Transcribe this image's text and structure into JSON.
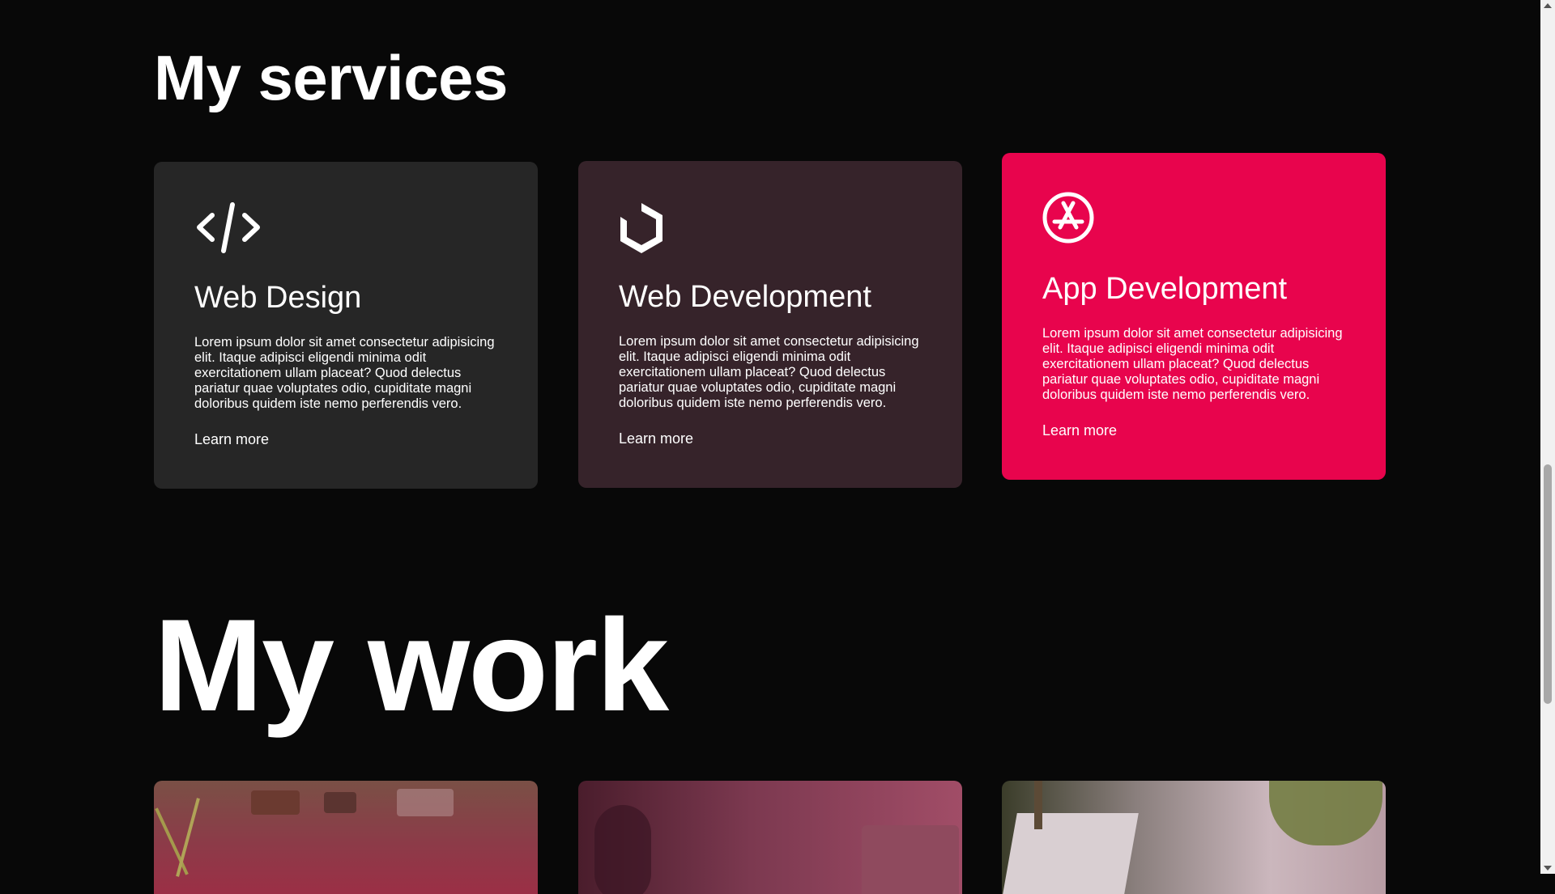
{
  "services": {
    "title": "My services",
    "cards": [
      {
        "icon": "code-icon",
        "title": "Web Design",
        "text": "Lorem ipsum dolor sit amet consectetur adipisicing elit. Itaque adipisci eligendi minima odit exercitationem ullam placeat? Quod delectus pariatur quae voluptates odio, cupiditate magni doloribus quidem iste nemo perferendis vero.",
        "link": "Learn more",
        "color": "#262626"
      },
      {
        "icon": "hexagon-box-icon",
        "title": "Web Development",
        "text": "Lorem ipsum dolor sit amet consectetur adipisicing elit. Itaque adipisci eligendi minima odit exercitationem ullam placeat? Quod delectus pariatur quae voluptates odio, cupiditate magni doloribus quidem iste nemo perferendis vero.",
        "link": "Learn more",
        "color": "#36232a"
      },
      {
        "icon": "app-store-icon",
        "title": "App Development",
        "text": "Lorem ipsum dolor sit amet consectetur adipisicing elit. Itaque adipisci eligendi minima odit exercitationem ullam placeat? Quod delectus pariatur quae voluptates odio, cupiditate magni doloribus quidem iste nemo perferendis vero.",
        "link": "Learn more",
        "color": "#e8044d"
      }
    ]
  },
  "work": {
    "title": "My work"
  },
  "colors": {
    "background": "#080808",
    "accent": "#e8044d"
  }
}
